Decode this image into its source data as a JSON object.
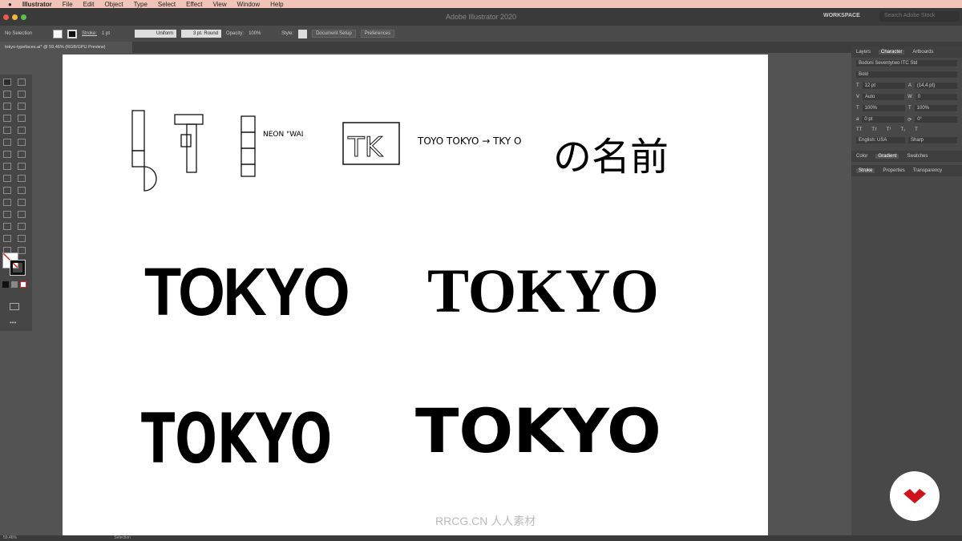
{
  "menubar": {
    "app": "Illustrator",
    "items": [
      "File",
      "Edit",
      "Object",
      "Type",
      "Select",
      "Effect",
      "View",
      "Window",
      "Help"
    ]
  },
  "appbar": {
    "title": "Adobe Illustrator 2020",
    "workspace": "WORKSPACE",
    "search_placeholder": "Search Adobe Stock"
  },
  "control": {
    "selection": "No Selection",
    "stroke_label": "Stroke:",
    "stroke_value": "1 pt",
    "profile": "Uniform",
    "brush": "3 pt. Round",
    "opacity_label": "Opacity:",
    "opacity": "100%",
    "style_label": "Style:",
    "doc_setup": "Document Setup",
    "preferences": "Preferences"
  },
  "document": {
    "tab": "tokyo-typefaces.ai* @ 59,46% (RGB/GPU Preview)"
  },
  "artboard": {
    "sketch_neon": "NEON \"WALL\"",
    "sketch_tokyo": "TOYO TOKYO → TKY OKO",
    "japanese": "の名前",
    "tokyo1": "TOKYO",
    "tokyo2": "TOKYO",
    "tokyo3": "TOKYO",
    "tokyo4": "TOKYO"
  },
  "panel": {
    "tabs": [
      "Layers",
      "Character",
      "Artboards"
    ],
    "font": "Bodoni Seventytwo ITC Std",
    "style": "Bold",
    "size": "12 pt",
    "leading": "(14,4 pt)",
    "kerning": "Auto",
    "tracking": "0",
    "vscale": "100%",
    "hscale": "100%",
    "baseline": "0 pt",
    "rotation": "0°",
    "language": "English: USA",
    "aa": "Sharp",
    "tabs2": [
      "Color",
      "Gradient",
      "Swatches"
    ],
    "tabs3": [
      "Stroke",
      "Properties",
      "Transparency"
    ]
  },
  "status": {
    "zoom": "59,46%",
    "tool": "Selection"
  },
  "watermark": "RRCG.CN 人人素材"
}
